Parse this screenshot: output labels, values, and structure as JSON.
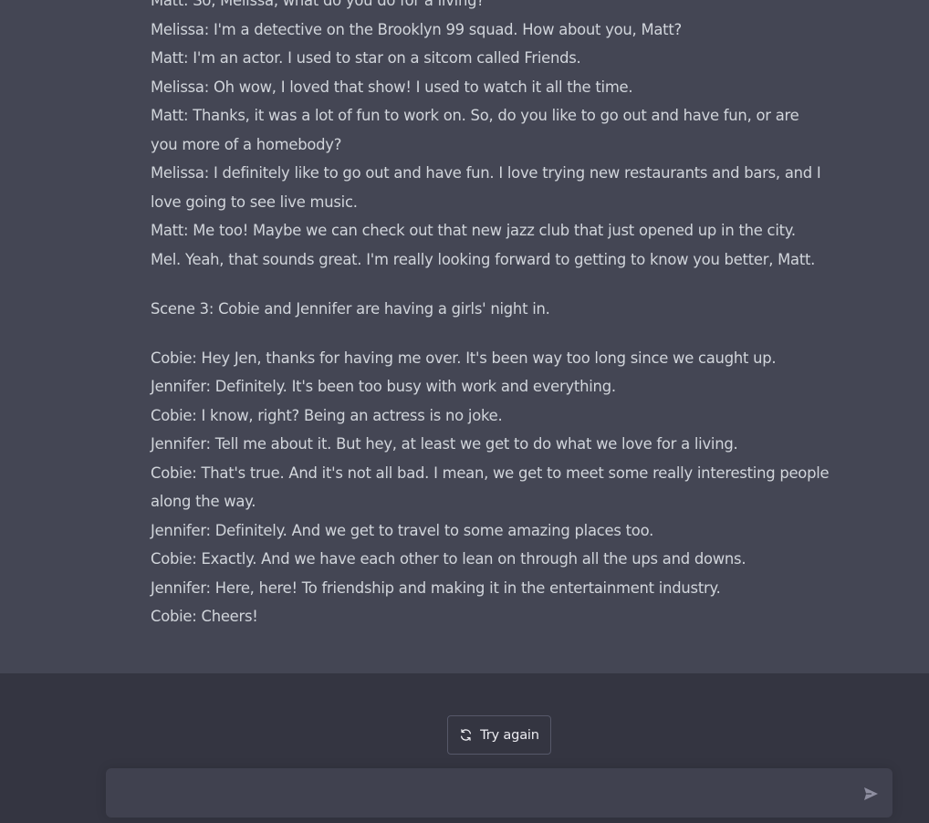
{
  "conversation": {
    "response_paragraphs": [
      {
        "lines": [
          "Matt: So, Melissa, what do you do for a living?",
          "Melissa: I'm a detective on the Brooklyn 99 squad. How about you, Matt?",
          "Matt: I'm an actor. I used to star on a sitcom called Friends.",
          "Melissa: Oh wow, I loved that show! I used to watch it all the time.",
          "Matt: Thanks, it was a lot of fun to work on. So, do you like to go out and have fun, or are",
          "you more of a homebody?",
          "Melissa: I definitely like to go out and have fun. I love trying new restaurants and bars, and I",
          "love going to see live music.",
          "Matt: Me too! Maybe we can check out that new jazz club that just opened up in the city.",
          "Mel. Yeah, that sounds great. I'm really looking forward to getting to know you better, Matt."
        ]
      },
      {
        "lines": [
          "Scene 3: Cobie and Jennifer are having a girls' night in."
        ]
      },
      {
        "lines": [
          "Cobie: Hey Jen, thanks for having me over. It's been way too long since we caught up.",
          "Jennifer: Definitely. It's been too busy with work and everything.",
          "Cobie: I know, right? Being an actress is no joke.",
          "Jennifer: Tell me about it. But hey, at least we get to do what we love for a living.",
          "Cobie: That's true. And it's not all bad. I mean, we get to meet some really interesting people",
          "along the way.",
          "Jennifer: Definitely. And we get to travel to some amazing places too.",
          "Cobie: Exactly. And we have each other to lean on through all the ups and downs.",
          "Jennifer: Here, here! To friendship and making it in the entertainment industry.",
          "Cobie: Cheers!"
        ]
      }
    ]
  },
  "footer": {
    "try_again_label": "Try again",
    "try_again_icon": "refresh-icon",
    "composer": {
      "value": "",
      "placeholder": ""
    },
    "send_icon": "send-icon"
  },
  "colors": {
    "response_background": "#444654",
    "page_background": "#343541",
    "composer_background": "#40414f",
    "text": "#d1d5db",
    "button_border": "#565869"
  }
}
